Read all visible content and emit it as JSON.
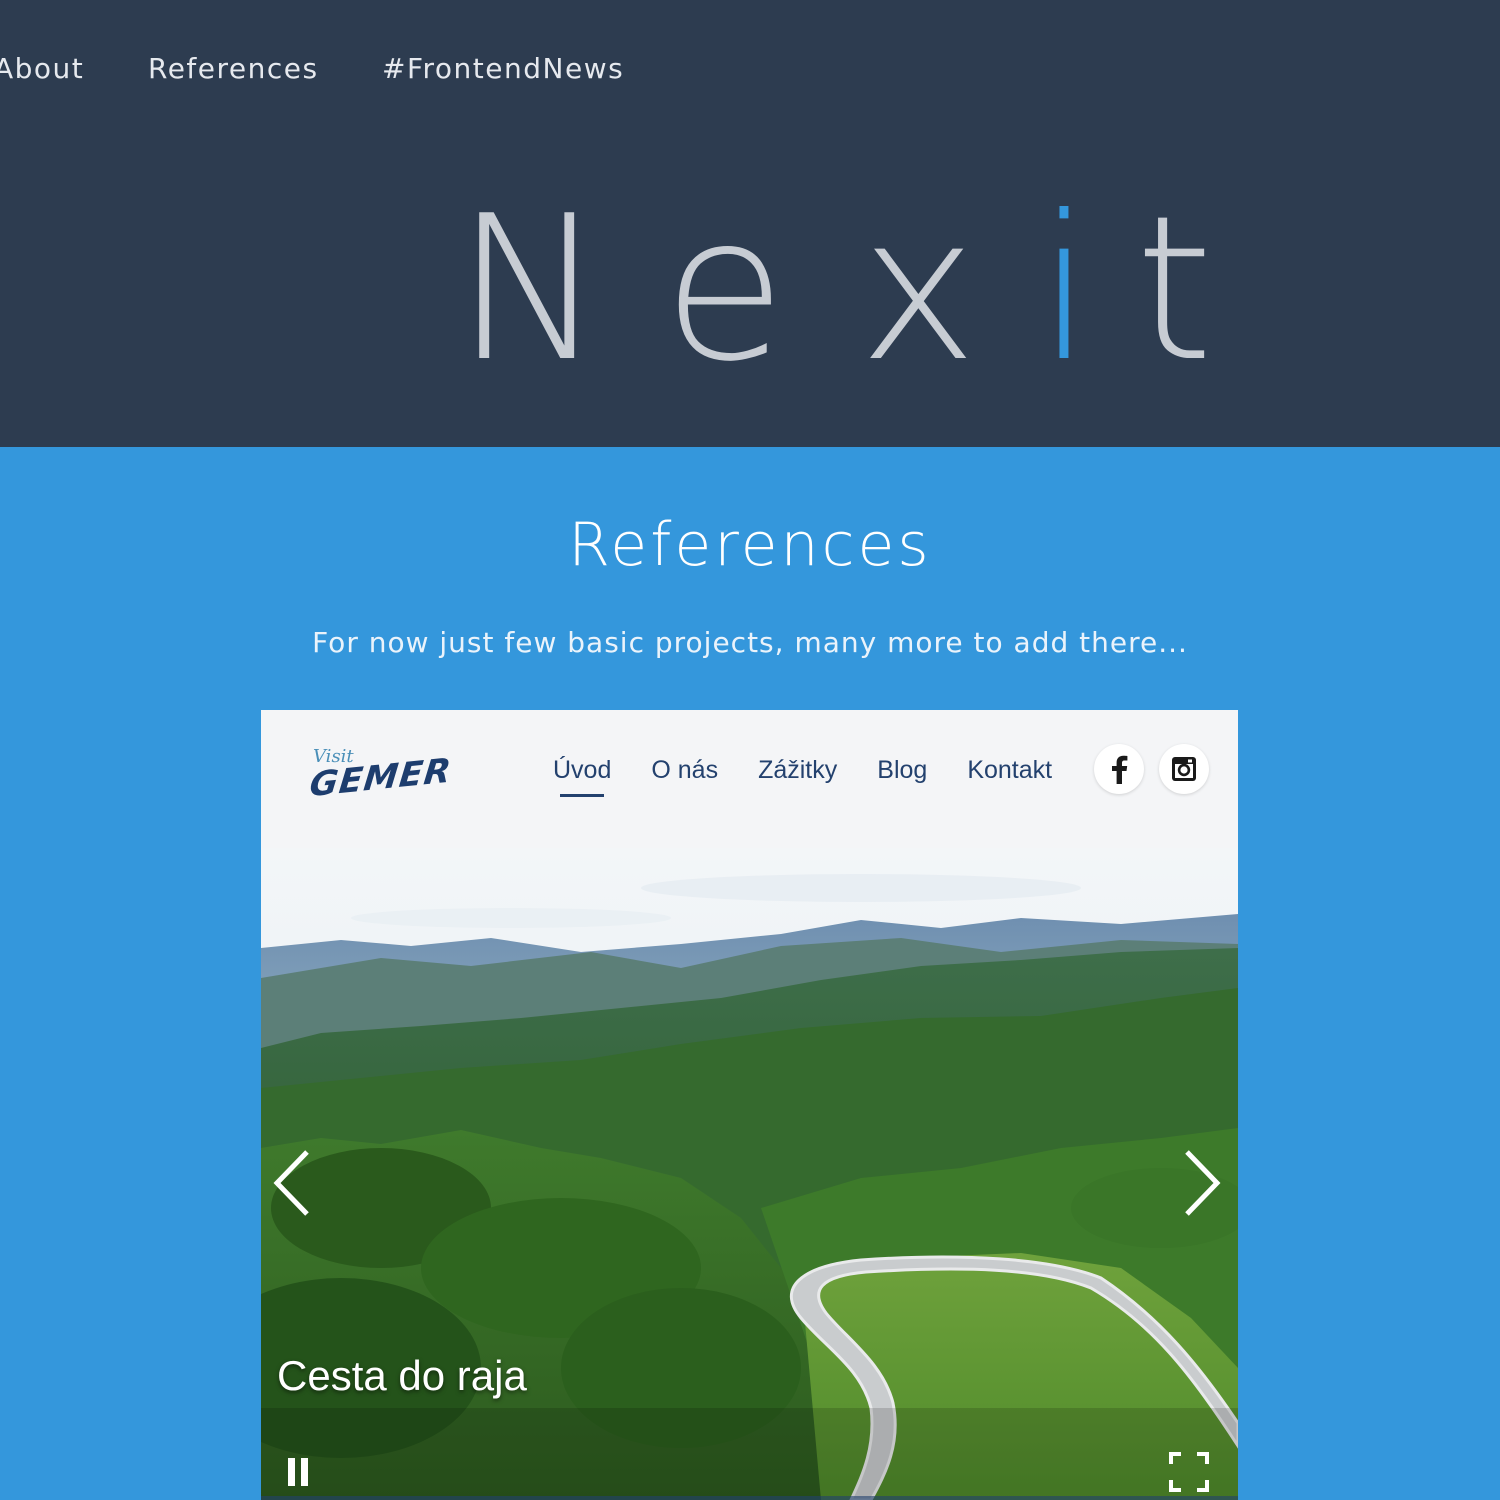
{
  "nav": {
    "items": [
      "About",
      "References",
      "#FrontendNews"
    ]
  },
  "logo": {
    "letters": [
      "N",
      "e",
      "x",
      "i",
      "t"
    ],
    "accent_color": "#3497dc"
  },
  "references": {
    "title": "References",
    "subtitle": "For now just few basic projects, many more to add there..."
  },
  "project": {
    "brand_top": "Visit",
    "brand_main": "GEMER",
    "menu": [
      "Úvod",
      "O nás",
      "Zážitky",
      "Blog",
      "Kontakt"
    ],
    "active_menu": "Úvod",
    "social": [
      "facebook-icon",
      "instagram-icon"
    ],
    "slide_caption": "Cesta do raja"
  },
  "colors": {
    "header_bg": "#2d3c50",
    "section_bg": "#3497dc",
    "card_nav_bg": "#f4f5f7",
    "menu_text": "#23416e"
  }
}
